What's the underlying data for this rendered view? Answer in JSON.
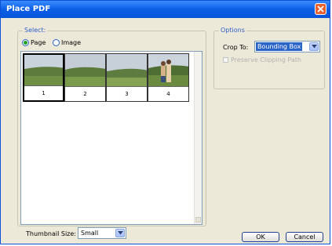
{
  "window": {
    "title": "Place PDF"
  },
  "select": {
    "legend": "Select:",
    "options": [
      {
        "label": "Page",
        "selected": true
      },
      {
        "label": "Image",
        "selected": false
      }
    ]
  },
  "thumbnails": [
    {
      "label": "1",
      "selected": true
    },
    {
      "label": "2",
      "selected": false
    },
    {
      "label": "3",
      "selected": false
    },
    {
      "label": "4",
      "selected": false
    }
  ],
  "thumbnail_size": {
    "label": "Thumbnail Size:",
    "value": "Small"
  },
  "options": {
    "legend": "Options",
    "crop_to": {
      "label": "Crop To:",
      "value": "Bounding Box"
    },
    "preserve_clipping_path": {
      "label": "Preserve Clipping Path",
      "enabled": false,
      "checked": false
    }
  },
  "buttons": {
    "ok": "OK",
    "cancel": "Cancel"
  },
  "colors": {
    "title_bar": "#0a55d8",
    "dialog_bg": "#ece9d8",
    "selection": "#2a63c7"
  },
  "icons": [
    "close-icon",
    "dropdown-arrow-icon",
    "scroll-down-icon"
  ]
}
